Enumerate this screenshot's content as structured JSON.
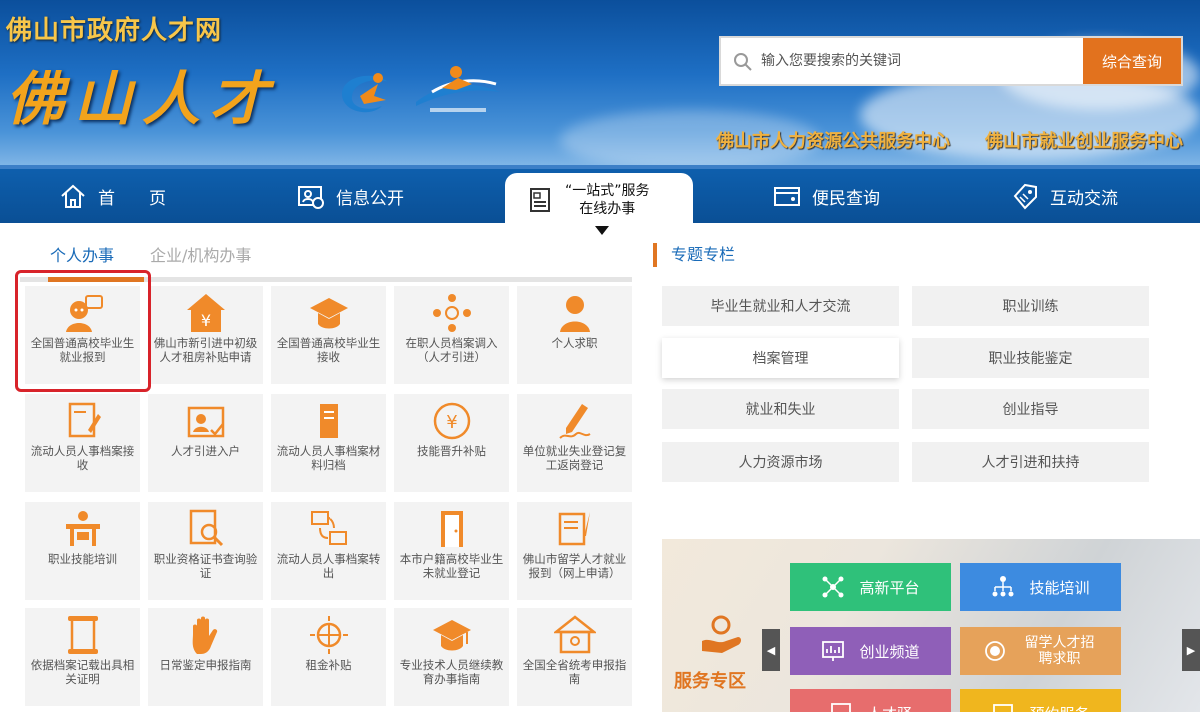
{
  "header": {
    "site_name": "佛山市政府人才网",
    "brand": "佛山人才",
    "search_placeholder": "输入您要搜索的关键词",
    "search_button": "综合查询",
    "center1": "佛山市人力资源公共服务中心",
    "center2": "佛山市就业创业服务中心"
  },
  "nav": {
    "home": "首　　页",
    "info": "信息公开",
    "onestop_l1": "“一站式”服务",
    "onestop_l2": "在线办事",
    "query": "便民查询",
    "interact": "互动交流"
  },
  "tabs": {
    "personal": "个人办事",
    "enterprise": "企业/机构办事"
  },
  "tiles": [
    "全国普通高校毕业生就业报到",
    "佛山市新引进中初级人才租房补贴申请",
    "全国普通高校毕业生接收",
    "在职人员档案调入（人才引进）",
    "个人求职",
    "流动人员人事档案接收",
    "人才引进入户",
    "流动人员人事档案材料归档",
    "技能晋升补贴",
    "单位就业失业登记复工返岗登记",
    "职业技能培训",
    "职业资格证书查询验证",
    "流动人员人事档案转出",
    "本市户籍高校毕业生未就业登记",
    "佛山市留学人才就业报到（网上申请）",
    "依据档案记载出具相关证明",
    "日常鉴定申报指南",
    "租金补贴",
    "专业技术人员继续教育办事指南",
    "全国全省统考申报指南"
  ],
  "topics": {
    "title": "专题专栏",
    "items": [
      "毕业生就业和人才交流",
      "职业训练",
      "档案管理",
      "职业技能鉴定",
      "就业和失业",
      "创业指导",
      "人力资源市场",
      "人才引进和扶持"
    ]
  },
  "service_zone": {
    "label": "服务专区",
    "buttons": [
      {
        "label": "高新平台",
        "color": "#2fc17a"
      },
      {
        "label": "技能培训",
        "color": "#3d8be0"
      },
      {
        "label": "创业频道",
        "color": "#8f5fb8"
      },
      {
        "label": "留学人才招聘求职",
        "color": "#e6a25a"
      },
      {
        "label": "人才驿",
        "color": "#e76d6d"
      },
      {
        "label": "预约服务",
        "color": "#f0b61e"
      }
    ],
    "prev": "◀",
    "next": "▶"
  },
  "colors": {
    "accent": "#e07622",
    "nav_bg": "#0a4f95",
    "link": "#1a6bb8",
    "highlight": "#d8232a"
  }
}
